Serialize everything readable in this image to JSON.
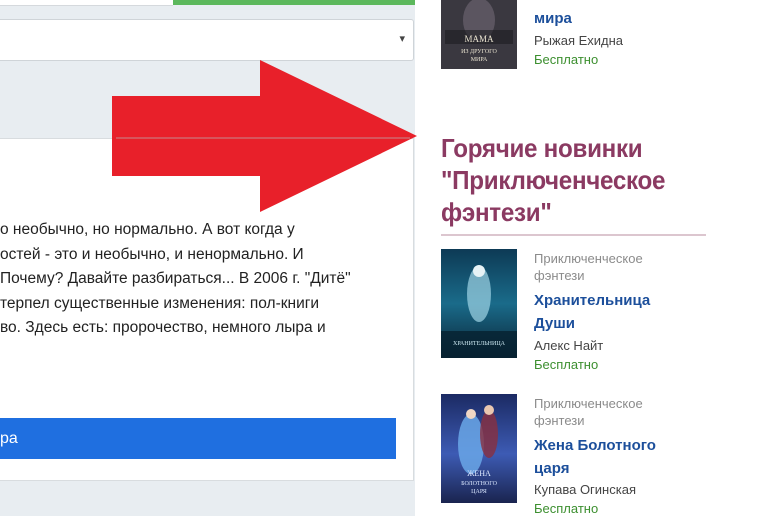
{
  "left": {
    "select": {
      "arrow": "▾"
    },
    "description_lines": [
      "о необычно, но нормально. А вот когда у",
      "остей - это и необычно, и ненормально. И",
      " Почему? Давайте разбираться... В 2006 г. \"Дитё\"",
      "терпел существенные изменения: пол-книги",
      "во. Здесь есть: пророчество, немного лыра и"
    ],
    "button_label": "ра"
  },
  "sidebar": {
    "top_book": {
      "title": "мира",
      "author": "Рыжая Ехидна",
      "price": "Бесплатно",
      "cover_text": "МАМА из другого мира"
    },
    "section_title": "Горячие новинки \"Приключенческое фэнтези\"",
    "books": [
      {
        "genre_line1": "Приключенческое",
        "genre_line2": "фэнтези",
        "title_line1": "Хранительница",
        "title_line2": "Души",
        "author": "Алекс Найт",
        "price": "Бесплатно"
      },
      {
        "genre_line1": "Приключенческое",
        "genre_line2": "фэнтези",
        "title_line1": "Жена Болотного",
        "title_line2": "царя",
        "author": "Купава Огинская",
        "price": "Бесплатно",
        "cover_text": "ЖЕНА БОЛОТНОГО ЦАРЯ"
      }
    ]
  },
  "colors": {
    "arrow": "#e8202a",
    "accent_title": "#8b3a62",
    "link": "#1c4f9b",
    "free": "#3c8f2f",
    "button": "#1f6fe0"
  }
}
